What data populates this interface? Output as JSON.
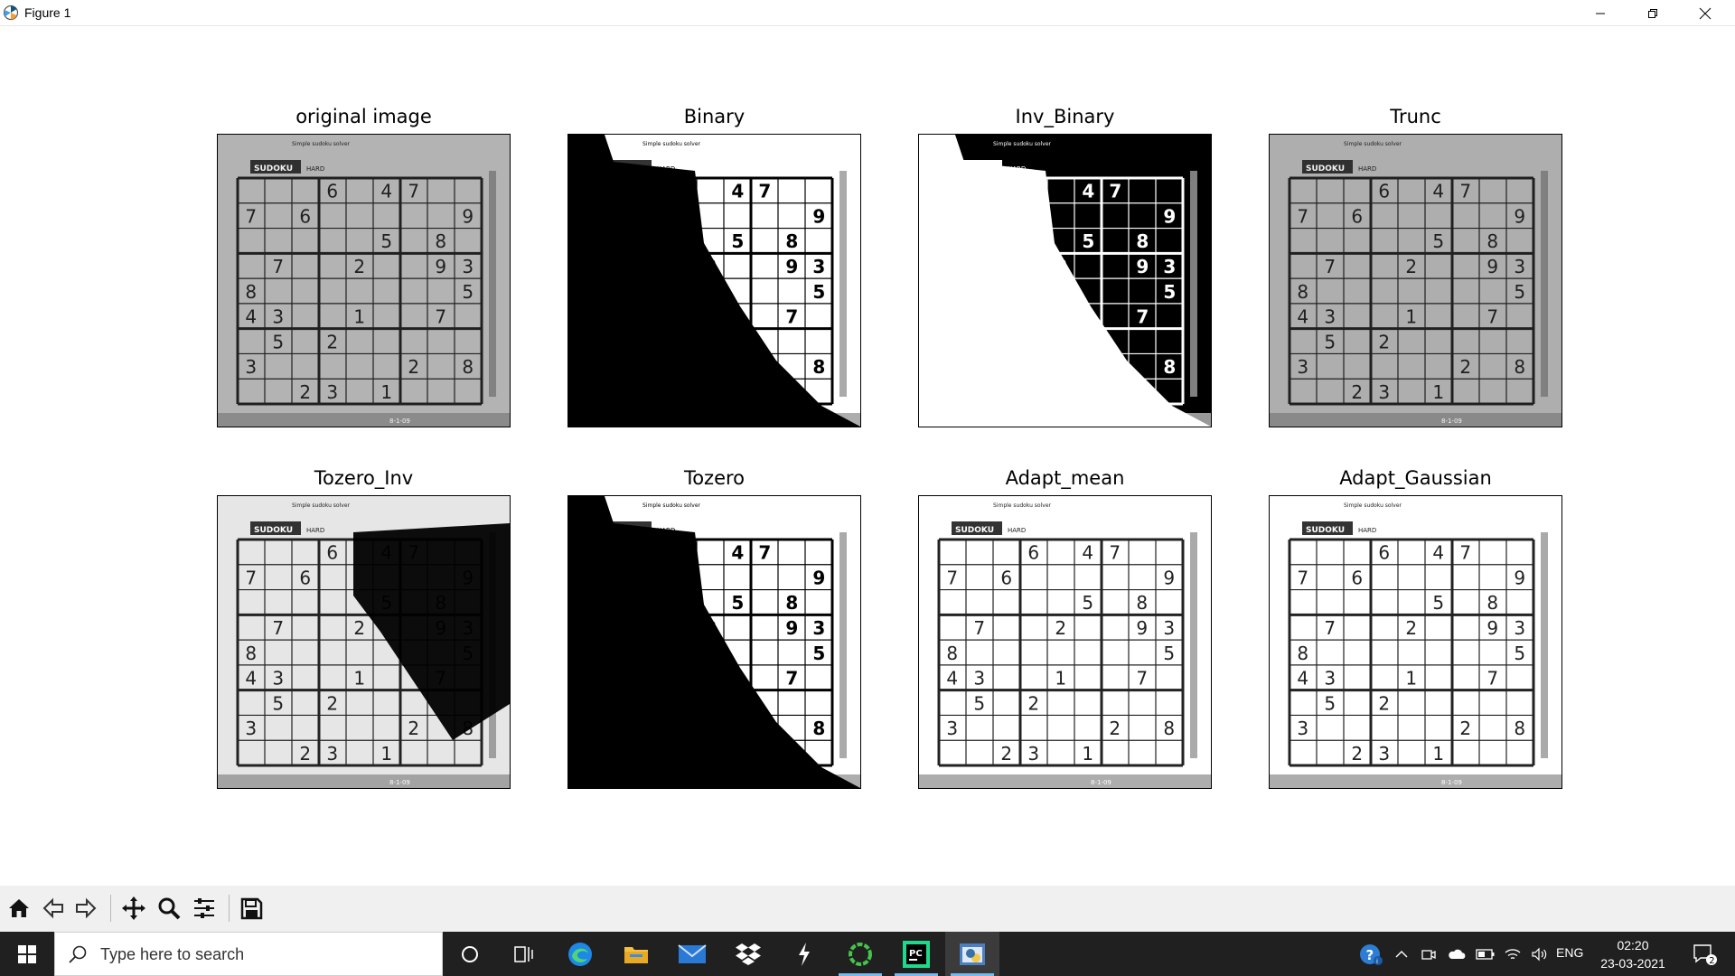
{
  "window": {
    "title": "Figure 1"
  },
  "subplots": [
    {
      "title": "original image",
      "style": "original"
    },
    {
      "title": "Binary",
      "style": "binary"
    },
    {
      "title": "Inv_Binary",
      "style": "inv_binary"
    },
    {
      "title": "Trunc",
      "style": "trunc"
    },
    {
      "title": "Tozero_Inv",
      "style": "tozero_inv"
    },
    {
      "title": "Tozero",
      "style": "tozero"
    },
    {
      "title": "Adapt_mean",
      "style": "adapt"
    },
    {
      "title": "Adapt_Gaussian",
      "style": "adapt"
    }
  ],
  "sudoku": {
    "header": "SUDOKU",
    "difficulty": "HARD",
    "blurb": "Simple sudoku solver",
    "footer": "8-1-09",
    "digits": [
      {
        "r": 0,
        "c": 3,
        "d": "6"
      },
      {
        "r": 0,
        "c": 5,
        "d": "4"
      },
      {
        "r": 0,
        "c": 6,
        "d": "7"
      },
      {
        "r": 1,
        "c": 0,
        "d": "7"
      },
      {
        "r": 1,
        "c": 2,
        "d": "6"
      },
      {
        "r": 1,
        "c": 8,
        "d": "9"
      },
      {
        "r": 2,
        "c": 5,
        "d": "5"
      },
      {
        "r": 2,
        "c": 7,
        "d": "8"
      },
      {
        "r": 3,
        "c": 1,
        "d": "7"
      },
      {
        "r": 3,
        "c": 4,
        "d": "2"
      },
      {
        "r": 3,
        "c": 7,
        "d": "9"
      },
      {
        "r": 3,
        "c": 8,
        "d": "3"
      },
      {
        "r": 4,
        "c": 0,
        "d": "8"
      },
      {
        "r": 4,
        "c": 8,
        "d": "5"
      },
      {
        "r": 5,
        "c": 0,
        "d": "4"
      },
      {
        "r": 5,
        "c": 1,
        "d": "3"
      },
      {
        "r": 5,
        "c": 4,
        "d": "1"
      },
      {
        "r": 5,
        "c": 7,
        "d": "7"
      },
      {
        "r": 6,
        "c": 1,
        "d": "5"
      },
      {
        "r": 6,
        "c": 3,
        "d": "2"
      },
      {
        "r": 7,
        "c": 0,
        "d": "3"
      },
      {
        "r": 7,
        "c": 6,
        "d": "2"
      },
      {
        "r": 7,
        "c": 8,
        "d": "8"
      },
      {
        "r": 8,
        "c": 2,
        "d": "2"
      },
      {
        "r": 8,
        "c": 3,
        "d": "3"
      },
      {
        "r": 8,
        "c": 5,
        "d": "1"
      }
    ]
  },
  "toolbar": {
    "buttons": [
      "home-icon",
      "back-icon",
      "forward-icon",
      "pan-icon",
      "zoom-icon",
      "configure-icon",
      "save-icon"
    ]
  },
  "taskbar": {
    "search_placeholder": "Type here to search",
    "language": "ENG",
    "time": "02:20",
    "date": "23-03-2021",
    "notification_count": "2",
    "apps": [
      "cortana-icon",
      "task-view-icon",
      "edge-icon",
      "file-explorer-icon",
      "mail-icon",
      "dropbox-icon",
      "lightning-app-icon",
      "green-app-icon",
      "pycharm-icon",
      "python-icon"
    ]
  }
}
